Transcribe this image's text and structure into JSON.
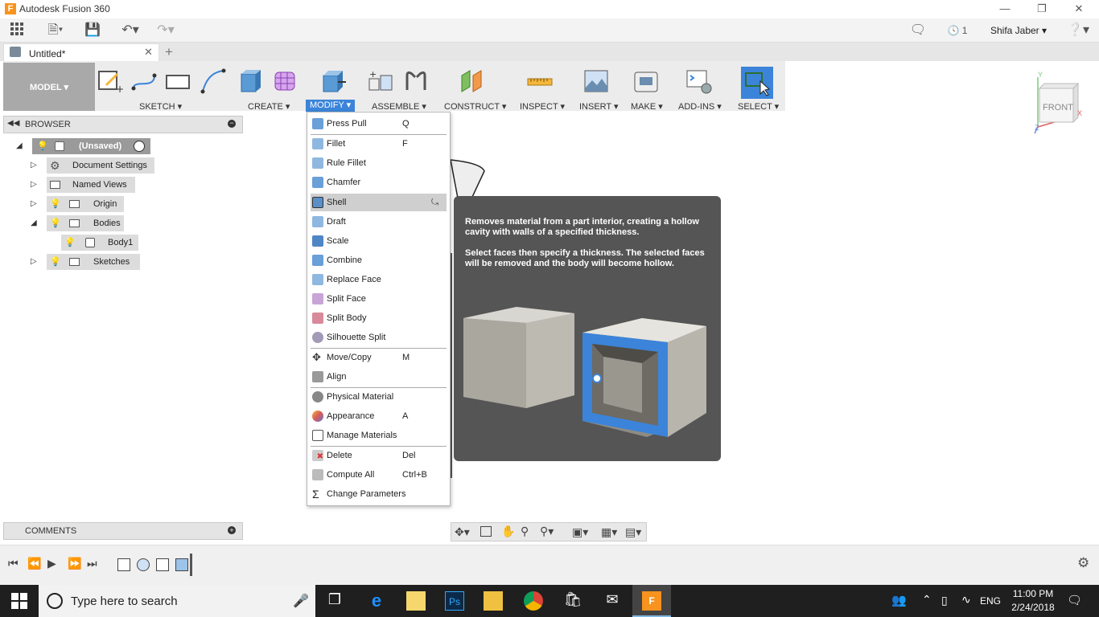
{
  "window": {
    "title": "Autodesk Fusion 360",
    "logo_letter": "F"
  },
  "qat": {
    "jobs_count": "1",
    "user": "Shifa Jaber"
  },
  "tabs": {
    "doc_title": "Untitled*"
  },
  "toolbar": {
    "workspace": "MODEL",
    "groups": [
      "SKETCH",
      "CREATE",
      "MODIFY",
      "ASSEMBLE",
      "CONSTRUCT",
      "INSPECT",
      "INSERT",
      "MAKE",
      "ADD-INS",
      "SELECT"
    ],
    "active_group": "MODIFY"
  },
  "browser": {
    "title": "BROWSER",
    "root": "(Unsaved)",
    "items": [
      "Document Settings",
      "Named Views",
      "Origin",
      "Bodies",
      "Body1",
      "Sketches"
    ]
  },
  "menu": {
    "items": [
      {
        "label": "Press Pull",
        "shortcut": "Q"
      },
      {
        "label": "Fillet",
        "shortcut": "F"
      },
      {
        "label": "Rule Fillet",
        "shortcut": ""
      },
      {
        "label": "Chamfer",
        "shortcut": ""
      },
      {
        "label": "Shell",
        "shortcut": ""
      },
      {
        "label": "Draft",
        "shortcut": ""
      },
      {
        "label": "Scale",
        "shortcut": ""
      },
      {
        "label": "Combine",
        "shortcut": ""
      },
      {
        "label": "Replace Face",
        "shortcut": ""
      },
      {
        "label": "Split Face",
        "shortcut": ""
      },
      {
        "label": "Split Body",
        "shortcut": ""
      },
      {
        "label": "Silhouette Split",
        "shortcut": ""
      },
      {
        "label": "Move/Copy",
        "shortcut": "M"
      },
      {
        "label": "Align",
        "shortcut": ""
      },
      {
        "label": "Physical Material",
        "shortcut": ""
      },
      {
        "label": "Appearance",
        "shortcut": "A"
      },
      {
        "label": "Manage Materials",
        "shortcut": ""
      },
      {
        "label": "Delete",
        "shortcut": "Del"
      },
      {
        "label": "Compute All",
        "shortcut": "Ctrl+B"
      },
      {
        "label": "Change Parameters",
        "shortcut": ""
      }
    ],
    "highlighted": "Shell"
  },
  "tooltip": {
    "line1": "Removes material from a part interior, creating a hollow cavity with walls of a specified thickness.",
    "line2": "Select faces then specify a thickness. The selected faces will be removed and the body will become hollow."
  },
  "viewcube": {
    "face": "FRONT",
    "axis_x": "X",
    "axis_y": "Y",
    "axis_z": "Z"
  },
  "comments": {
    "title": "COMMENTS"
  },
  "taskbar": {
    "search_placeholder": "Type here to search",
    "lang": "ENG",
    "time": "11:00 PM",
    "date": "2/24/2018"
  },
  "colors": {
    "accent": "#3b84d9",
    "tooltip_bg": "#555555",
    "taskbar": "#1f1f1f",
    "orange": "#f7931e"
  }
}
